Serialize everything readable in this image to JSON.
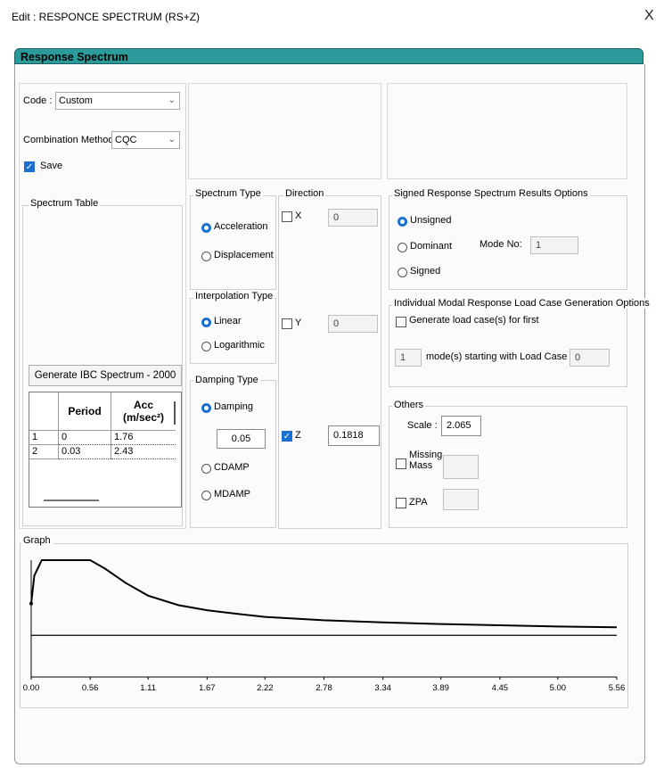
{
  "window": {
    "title": "Edit : RESPONCE SPECTRUM (RS+Z)",
    "close": "X"
  },
  "banner": "Response Spectrum",
  "code": {
    "label": "Code :",
    "value": "Custom"
  },
  "combination": {
    "label": "Combination Method",
    "value": "CQC"
  },
  "save": {
    "label": "Save",
    "checked": true
  },
  "spectrum_table": {
    "label": "Spectrum Table",
    "generate_button": "Generate IBC Spectrum - 2000",
    "headers": [
      "Period",
      "Acc",
      "(m/sec²)"
    ],
    "rows": [
      {
        "n": "1",
        "period": "0",
        "acc": "1.76"
      },
      {
        "n": "2",
        "period": "0.03",
        "acc": "2.43"
      }
    ]
  },
  "spectrum_type": {
    "label": "Spectrum Type",
    "options": [
      "Acceleration",
      "Displacement"
    ],
    "selected": "Acceleration"
  },
  "interpolation": {
    "label": "Interpolation Type",
    "options": [
      "Linear",
      "Logarithmic"
    ],
    "selected": "Linear"
  },
  "damping": {
    "label": "Damping Type",
    "options": [
      "Damping",
      "CDAMP",
      "MDAMP"
    ],
    "selected": "Damping",
    "value": "0.05"
  },
  "direction": {
    "label": "Direction",
    "x": {
      "label": "X",
      "value": "0",
      "checked": false
    },
    "y": {
      "label": "Y",
      "value": "0",
      "checked": false
    },
    "z": {
      "label": "Z",
      "value": "0.1818",
      "checked": true
    }
  },
  "signed": {
    "label": "Signed Response Spectrum Results Options",
    "unsigned": "Unsigned",
    "dominant": "Dominant",
    "signed": "Signed",
    "selected": "Unsigned",
    "mode_label": "Mode No:",
    "mode_value": "1"
  },
  "modal": {
    "label": "Individual Modal Response Load Case Generation Options",
    "generate": "Generate load case(s) for first",
    "count": "1",
    "starting": "mode(s) starting with Load Case no.",
    "case_no": "0"
  },
  "others": {
    "label": "Others",
    "scale_label": "Scale :",
    "scale_value": "2.065",
    "missing_mass_1": "Missing",
    "missing_mass_2": "Mass",
    "zpa": "ZPA"
  },
  "graph": {
    "label": "Graph"
  },
  "chart_data": {
    "type": "line",
    "x_ticks": [
      "0.00",
      "0.56",
      "1.11",
      "1.67",
      "2.22",
      "2.78",
      "3.34",
      "3.89",
      "4.45",
      "5.00",
      "5.56"
    ],
    "xlim": [
      0,
      5.56
    ],
    "reference_line": 1.0,
    "x": [
      0,
      0.03,
      0.1,
      0.56,
      0.7,
      0.9,
      1.11,
      1.4,
      1.67,
      2.0,
      2.22,
      2.78,
      3.34,
      3.89,
      4.45,
      5.0,
      5.56
    ],
    "y": [
      1.76,
      2.43,
      2.8,
      2.8,
      2.6,
      2.25,
      1.95,
      1.72,
      1.6,
      1.5,
      1.44,
      1.36,
      1.31,
      1.27,
      1.24,
      1.21,
      1.19
    ],
    "colors": {
      "curve": "#000000",
      "axis": "#000000"
    }
  }
}
